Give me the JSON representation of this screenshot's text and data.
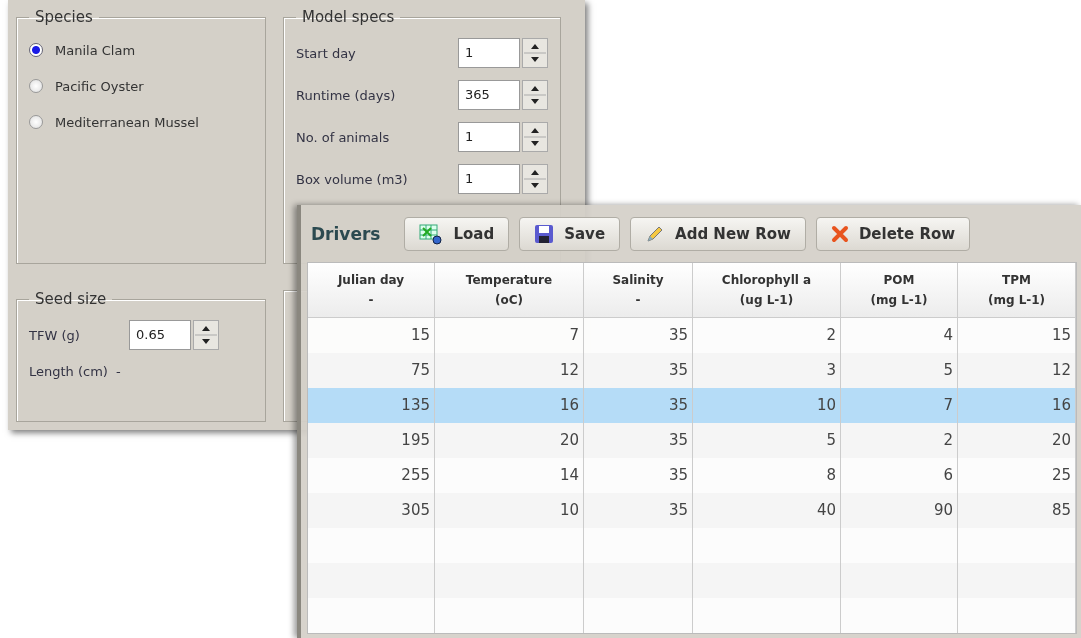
{
  "species": {
    "title": "Species",
    "options": [
      {
        "label": "Manila Clam",
        "selected": true
      },
      {
        "label": "Pacific Oyster",
        "selected": false
      },
      {
        "label": "Mediterranean Mussel",
        "selected": false
      }
    ]
  },
  "model_specs": {
    "title": "Model specs",
    "fields": [
      {
        "label": "Start day",
        "value": "1"
      },
      {
        "label": "Runtime (days)",
        "value": "365"
      },
      {
        "label": "No. of animals",
        "value": "1"
      },
      {
        "label": "Box volume (m3)",
        "value": "1"
      }
    ]
  },
  "seed_size": {
    "title": "Seed size",
    "tfw_label": "TFW (g)",
    "tfw_value": "0.65",
    "length_label": "Length (cm)",
    "length_value": "-"
  },
  "drivers": {
    "title": "Drivers",
    "buttons": [
      {
        "label": "Load",
        "kind": "load"
      },
      {
        "label": "Save",
        "kind": "save"
      },
      {
        "label": "Add New Row",
        "kind": "add"
      },
      {
        "label": "Delete Row",
        "kind": "delete"
      }
    ],
    "columns": [
      {
        "name": "Julian day",
        "unit": "-"
      },
      {
        "name": "Temperature",
        "unit": "(oC)"
      },
      {
        "name": "Salinity",
        "unit": "-"
      },
      {
        "name": "Chlorophyll a",
        "unit": "(ug L-1)"
      },
      {
        "name": "POM",
        "unit": "(mg L-1)"
      },
      {
        "name": "TPM",
        "unit": "(mg L-1)"
      }
    ],
    "rows": [
      {
        "cells": [
          "15",
          "7",
          "35",
          "2",
          "4",
          "15"
        ],
        "selected": false
      },
      {
        "cells": [
          "75",
          "12",
          "35",
          "3",
          "5",
          "12"
        ],
        "selected": false
      },
      {
        "cells": [
          "135",
          "16",
          "35",
          "10",
          "7",
          "16"
        ],
        "selected": true
      },
      {
        "cells": [
          "195",
          "20",
          "35",
          "5",
          "2",
          "20"
        ],
        "selected": false
      },
      {
        "cells": [
          "255",
          "14",
          "35",
          "8",
          "6",
          "25"
        ],
        "selected": false
      },
      {
        "cells": [
          "305",
          "10",
          "35",
          "40",
          "90",
          "85"
        ],
        "selected": false
      }
    ]
  }
}
